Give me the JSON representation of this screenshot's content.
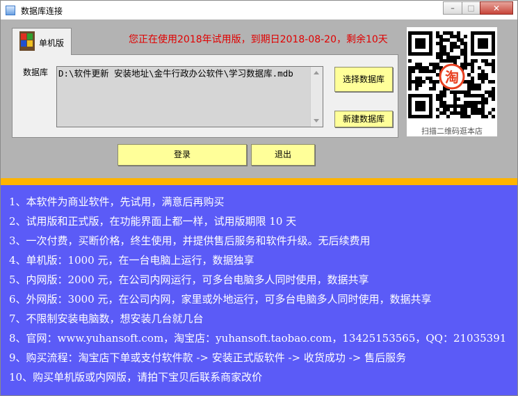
{
  "window": {
    "title": "数据库连接",
    "min_glyph": "–",
    "max_glyph": "□",
    "close_glyph": "✕"
  },
  "tab": {
    "label": "单机版",
    "icon": "windows-flag-icon"
  },
  "trial_notice": "您正在使用2018年试用版，到期日2018-08-20，剩余10天",
  "database": {
    "label": "数据库",
    "path": "D:\\软件更新 安装地址\\金牛行政办公软件\\学习数据库.mdb"
  },
  "buttons": {
    "select_db": "选择数据库",
    "new_db": "新建数据库",
    "login": "登录",
    "exit": "退出"
  },
  "qr": {
    "caption": "扫描二维码逛本店",
    "center_glyph": "淘"
  },
  "info_lines": [
    "1、本软件为商业软件，先试用，满意后再购买",
    "2、试用版和正式版，在功能界面上都一样，试用版期限 10 天",
    "3、一次付费，买断价格，终生使用，并提供售后服务和软件升级。无后续费用",
    "4、单机版：1000 元，在一台电脑上运行，数据独享",
    "5、内网版：2000 元，在公司内网运行，可多台电脑多人同时使用，数据共享",
    "6、外网版：3000 元，在公司内网，家里或外地运行，可多台电脑多人同时使用，数据共享",
    "7、不限制安装电脑数，想安装几台就几台",
    "8、官网：www.yuhansoft.com，淘宝店：yuhansoft.taobao.com，13425153565，QQ：21035391",
    "9、购买流程：淘宝店下单或支付软件款 -> 安装正式版软件 -> 收货成功 -> 售后服务",
    "10、购买单机版或内网版，请拍下宝贝后联系商家改价"
  ],
  "colors": {
    "info_bg": "#5b5bf7",
    "accent_bar": "#ffb400",
    "button_yellow": "#ffff99",
    "trial_red": "#e00000"
  }
}
